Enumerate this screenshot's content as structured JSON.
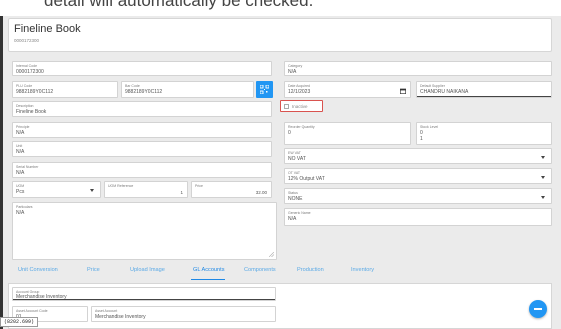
{
  "top_banner": {
    "text": "detail will automatically be checked."
  },
  "header": {
    "title": "Fineline Book",
    "code": "0000172300"
  },
  "left": {
    "internal_code": {
      "label": "Internal Code",
      "value": "0000172300"
    },
    "plu_code": {
      "label": "PLU Code",
      "value": "9882189Y0C112"
    },
    "bar_code": {
      "label": "Bar Code",
      "value": "9882189Y0C112"
    },
    "description": {
      "label": "Description",
      "value": "Fineline Book"
    },
    "principle": {
      "label": "Principle",
      "value": "N/A"
    },
    "unit": {
      "label": "Unit",
      "value": "N/A"
    },
    "serial_number": {
      "label": "Serial Number",
      "value": "N/A"
    },
    "uom": {
      "label": "UOM",
      "value": "Pcs"
    },
    "uom_reference": {
      "label": "UOM Reference",
      "value": "1"
    },
    "price": {
      "label": "Price",
      "value": "32.00"
    },
    "particulars": {
      "label": "Particulars",
      "value": "N/A"
    }
  },
  "right": {
    "category": {
      "label": "Category",
      "value": "N/A"
    },
    "date_acquired": {
      "label": "Date Acquired",
      "value": "12/1/2023"
    },
    "default_supplier": {
      "label": "Default Supplier",
      "value": "CHANDRU NAIKANA"
    },
    "inactive": {
      "label": "Inactive"
    },
    "reorder_quantity": {
      "label": "Reorder Quantity",
      "value": "0"
    },
    "stock_level": {
      "label": "Stock Level",
      "value": "0"
    },
    "stock_level_sub": "1",
    "ew_vat": {
      "label": "EW VAT",
      "value": "NO VAT"
    },
    "ot_vat": {
      "label": "OT VAT",
      "value": "12% Output VAT"
    },
    "status": {
      "label": "Status",
      "value": "NONE"
    },
    "generic_name": {
      "label": "Generic Name",
      "value": "N/A"
    }
  },
  "tabs": [
    "Unit Conversion",
    "Price",
    "Upload Image",
    "GL Accounts",
    "Components",
    "Production",
    "Inventory"
  ],
  "active_tab": "GL Accounts",
  "gl": {
    "account_group": {
      "label": "Account Group",
      "value": "Merchandise Inventory"
    },
    "asset_account_code": {
      "label": "Asset Account Code",
      "value": "01"
    },
    "asset_account": {
      "label": "Asset Account",
      "value": "Merchandise Inventory"
    }
  },
  "coordinate_readout": "(8202.699)",
  "colors": {
    "accent": "#2196f3",
    "tab_inactive": "#5aa9e6",
    "inactive_border": "#d9534f"
  }
}
